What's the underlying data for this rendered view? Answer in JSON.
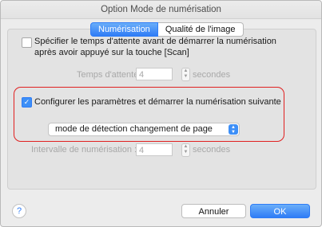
{
  "window": {
    "title": "Option Mode de numérisation"
  },
  "tabs": [
    {
      "label": "Numérisation",
      "active": true
    },
    {
      "label": "Qualité de l'image",
      "active": false
    }
  ],
  "wait_option": {
    "checkbox_checked": false,
    "label_line1": "Spécifier le temps d'attente avant de démarrer la numérisation",
    "label_line2": "après avoir appuyé sur la touche [Scan]",
    "wait_time_label": "Temps d'attente :",
    "wait_time_value": "4",
    "wait_time_unit": "secondes"
  },
  "next_scan_option": {
    "checkbox_checked": true,
    "label": "Configurer les paramètres et démarrer la numérisation suivante",
    "mode_selected": "mode de détection changement de page",
    "interval_label": "Intervalle de numérisation :",
    "interval_value": "4",
    "interval_unit": "secondes"
  },
  "footer": {
    "help_label": "?",
    "cancel_label": "Annuler",
    "ok_label": "OK"
  },
  "colors": {
    "accent": "#2f7cf6",
    "highlight": "#e02020"
  }
}
